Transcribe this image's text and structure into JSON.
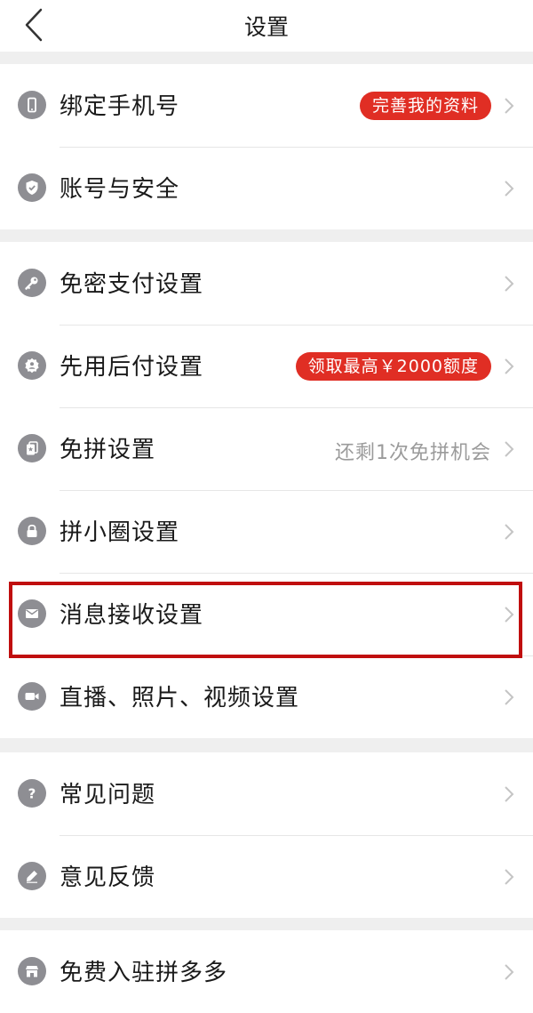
{
  "header": {
    "title": "设置",
    "back_icon": "chevron-left-icon"
  },
  "sections": [
    {
      "rows": [
        {
          "id": "bind-phone",
          "icon": "phone-icon",
          "label": "绑定手机号",
          "badge": "完善我的资料"
        },
        {
          "id": "account-security",
          "icon": "shield-check-icon",
          "label": "账号与安全"
        }
      ]
    },
    {
      "rows": [
        {
          "id": "password-free-pay",
          "icon": "key-icon",
          "label": "免密支付设置"
        },
        {
          "id": "pay-later",
          "icon": "badge-person-icon",
          "label": "先用后付设置",
          "badge": "领取最高￥2000额度"
        },
        {
          "id": "free-group",
          "icon": "star-card-icon",
          "label": "免拼设置",
          "note": "还剩1次免拼机会"
        },
        {
          "id": "circle",
          "icon": "lock-icon",
          "label": "拼小圈设置"
        },
        {
          "id": "message",
          "icon": "mail-icon",
          "label": "消息接收设置"
        },
        {
          "id": "media",
          "icon": "video-camera-icon",
          "label": "直播、照片、视频设置"
        }
      ]
    },
    {
      "rows": [
        {
          "id": "faq",
          "icon": "question-icon",
          "label": "常见问题"
        },
        {
          "id": "feedback",
          "icon": "pencil-icon",
          "label": "意见反馈"
        }
      ]
    },
    {
      "rows": [
        {
          "id": "merchant",
          "icon": "store-icon",
          "label": "免费入驻拼多多"
        }
      ]
    }
  ],
  "colors": {
    "accent": "#e02e24",
    "highlight": "#c00e0e",
    "icon_bg": "#8e8e93",
    "page_bg": "#efefef"
  }
}
